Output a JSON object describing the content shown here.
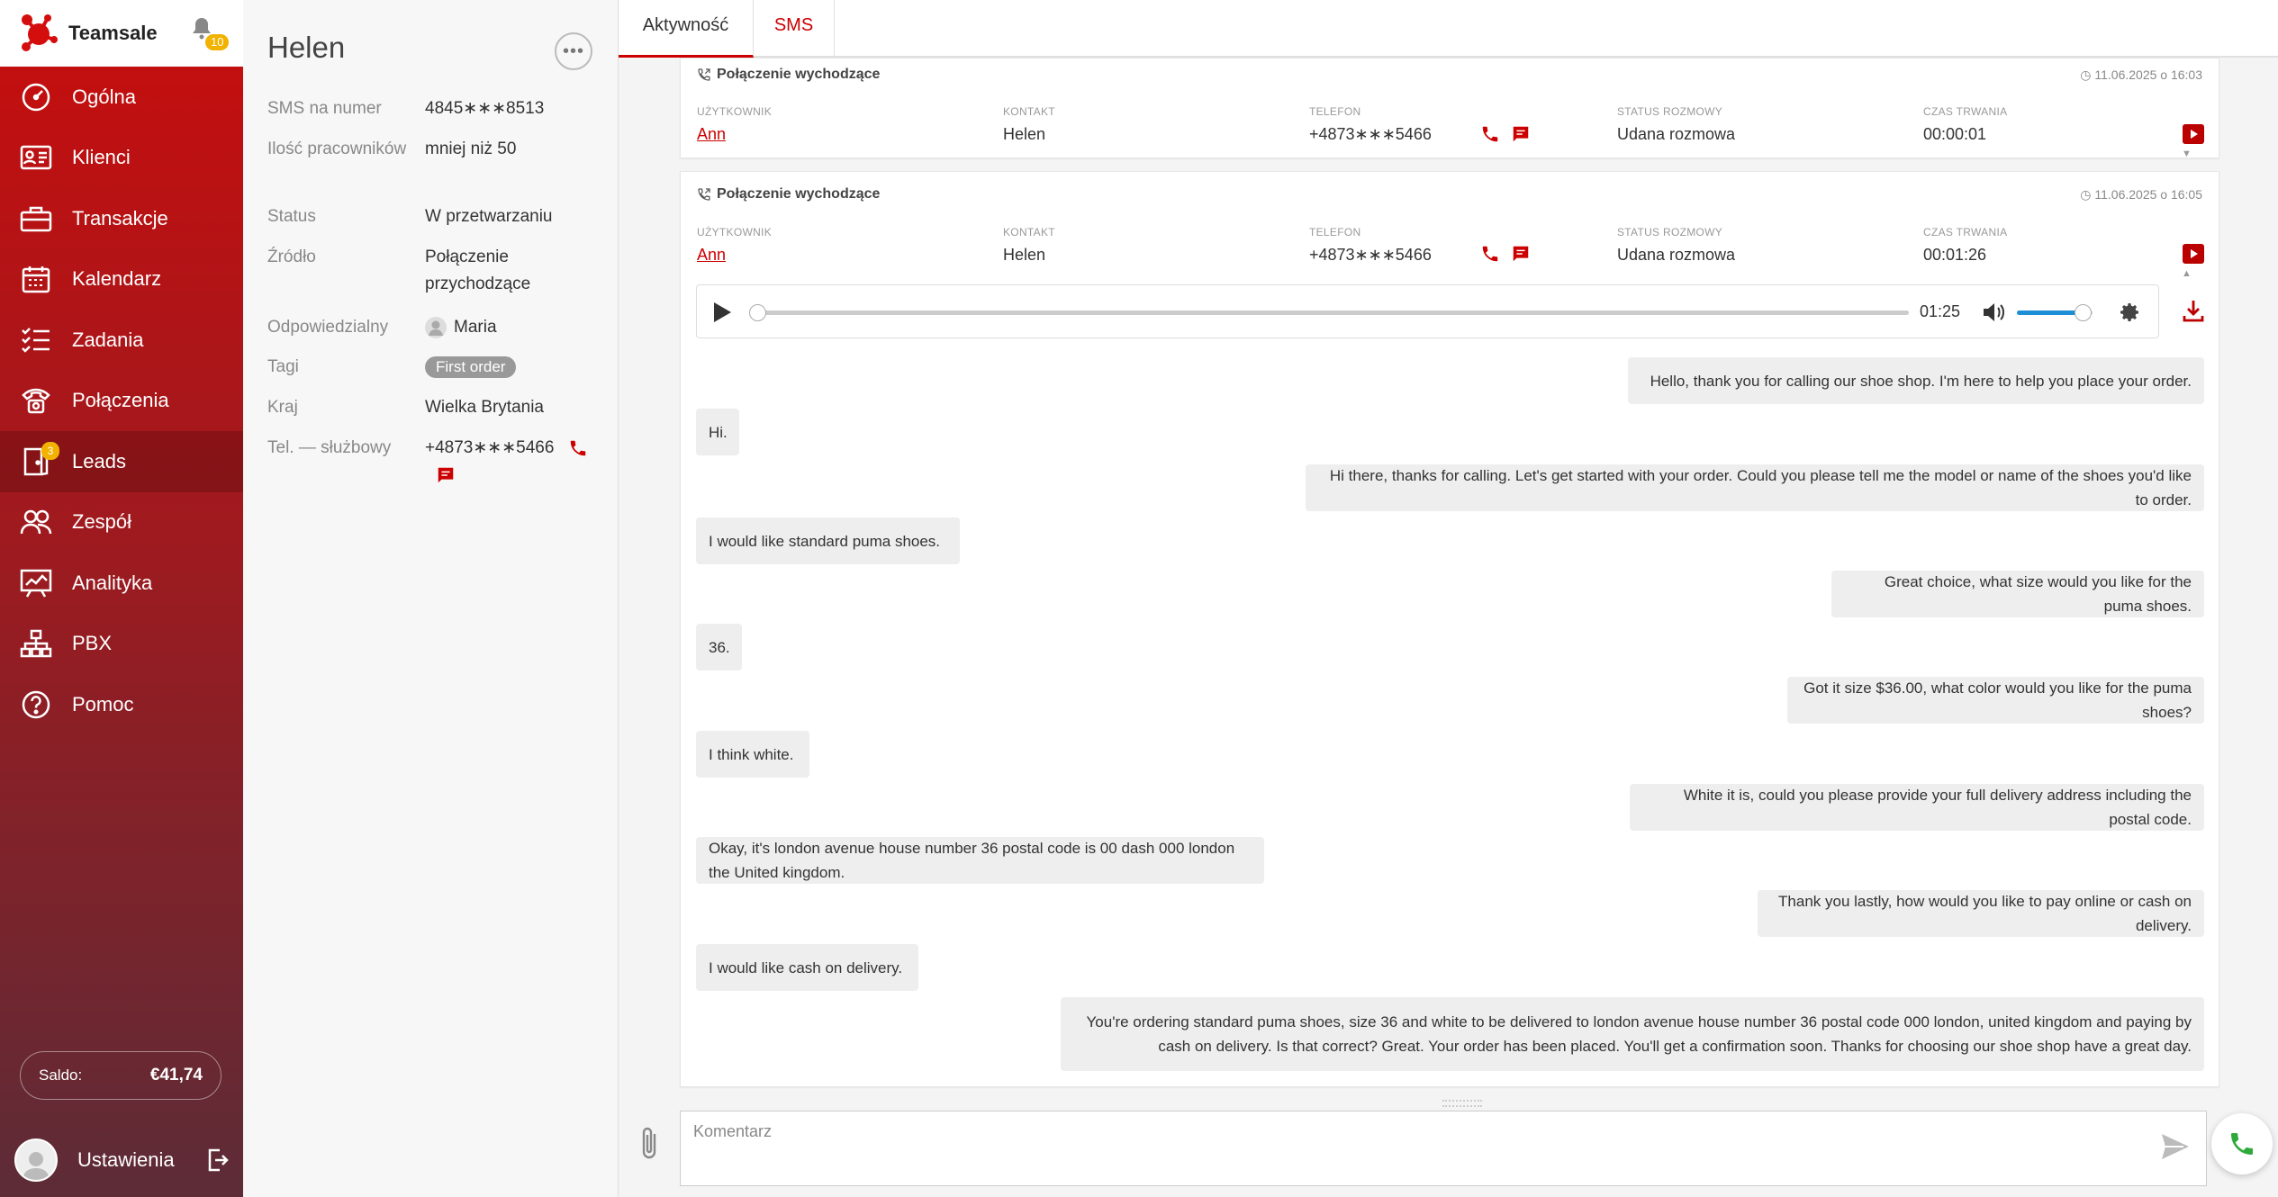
{
  "brand": {
    "name": "Teamsale",
    "notifications": "10"
  },
  "nav": [
    {
      "label": "Ogólna",
      "icon": "gauge-icon"
    },
    {
      "label": "Klienci",
      "icon": "contact-card-icon"
    },
    {
      "label": "Transakcje",
      "icon": "briefcase-icon"
    },
    {
      "label": "Kalendarz",
      "icon": "calendar-icon"
    },
    {
      "label": "Zadania",
      "icon": "checklist-icon"
    },
    {
      "label": "Połączenia",
      "icon": "phone-icon"
    },
    {
      "label": "Leads",
      "icon": "leads-icon",
      "badge": "3",
      "active": true
    },
    {
      "label": "Zespół",
      "icon": "team-icon"
    },
    {
      "label": "Analityka",
      "icon": "chart-board-icon"
    },
    {
      "label": "PBX",
      "icon": "network-icon"
    },
    {
      "label": "Pomoc",
      "icon": "help-icon"
    }
  ],
  "saldo": {
    "label": "Saldo:",
    "value": "€41,74"
  },
  "settings": {
    "label": "Ustawienia"
  },
  "contact": {
    "name": "Helen",
    "fields": [
      {
        "key": "SMS na numer",
        "value": "4845∗∗∗8513"
      },
      {
        "key": "Ilość pracowników",
        "value": "mniej niż 50"
      },
      {
        "key": "Status",
        "value": "W przetwarzaniu"
      },
      {
        "key": "Źródło",
        "value": "Połączenie przychodzące"
      },
      {
        "key": "Odpowiedzialny",
        "value": "Maria"
      },
      {
        "key": "Tagi",
        "value": "First order"
      },
      {
        "key": "Kraj",
        "value": "Wielka Brytania"
      },
      {
        "key": "Tel. — służbowy",
        "value": "+4873∗∗∗5466"
      }
    ]
  },
  "tabs": [
    {
      "label": "Aktywność"
    },
    {
      "label": "SMS"
    }
  ],
  "calls": [
    {
      "title": "Połączenie wychodzące",
      "date": "11.06.2025 o 16:03",
      "cols": {
        "user_label": "UŻYTKOWNIK",
        "user": "Ann",
        "contact_label": "KONTAKT",
        "contact": "Helen",
        "phone_label": "TELEFON",
        "phone": "+4873∗∗∗5466",
        "status_label": "STATUS ROZMOWY",
        "status": "Udana rozmowa",
        "duration_label": "CZAS TRWANIA",
        "duration": "00:00:01"
      }
    },
    {
      "title": "Połączenie wychodzące",
      "date": "11.06.2025 o 16:05",
      "cols": {
        "user_label": "UŻYTKOWNIK",
        "user": "Ann",
        "contact_label": "KONTAKT",
        "contact": "Helen",
        "phone_label": "TELEFON",
        "phone": "+4873∗∗∗5466",
        "status_label": "STATUS ROZMOWY",
        "status": "Udana rozmowa",
        "duration_label": "CZAS TRWANIA",
        "duration": "00:01:26"
      },
      "player": {
        "time": "01:25",
        "progress": 0.0,
        "volume": 0.85
      }
    }
  ],
  "transcript": [
    {
      "side": "agent",
      "text": "Hello, thank you for calling our shoe shop. I'm here to help you place your order."
    },
    {
      "side": "client",
      "text": "Hi."
    },
    {
      "side": "agent",
      "text": "Hi there, thanks for calling. Let's get started with your order. Could you please tell me the model or name of the shoes you'd like to order."
    },
    {
      "side": "client",
      "text": "I would like standard puma shoes."
    },
    {
      "side": "agent",
      "text": "Great choice, what size would you like for the puma shoes."
    },
    {
      "side": "client",
      "text": "36."
    },
    {
      "side": "agent",
      "text": "Got it size $36.00, what color would you like for the puma shoes?"
    },
    {
      "side": "client",
      "text": "I think white."
    },
    {
      "side": "agent",
      "text": "White it is, could you please provide your full delivery address including the postal code."
    },
    {
      "side": "client",
      "text": "Okay, it's london avenue house number 36 postal code is 00 dash 000 london the United kingdom."
    },
    {
      "side": "agent",
      "text": "Thank you lastly, how would you like to pay online or cash on delivery."
    },
    {
      "side": "client",
      "text": "I would like cash on delivery."
    },
    {
      "side": "agent",
      "text": "You're ordering standard puma shoes, size 36 and white to be delivered to london avenue house number 36 postal code 000 london, united kingdom and paying by cash on delivery. Is that correct? Great. Your order has been placed. You'll get a confirmation soon. Thanks for choosing our shoe shop have a great day."
    }
  ],
  "compose": {
    "placeholder": "Komentarz"
  },
  "colors": {
    "brand": "#c80d0d",
    "accent_blue": "#1e8fd6",
    "badge": "#f2b200",
    "call_green": "#2eaa3c"
  }
}
